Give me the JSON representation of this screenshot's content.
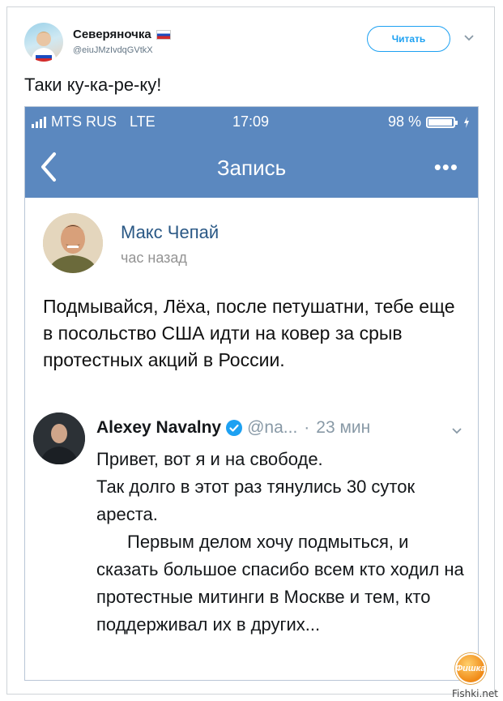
{
  "tweet": {
    "display_name": "Северяночка",
    "handle": "@eiuJMzIvdqGVtkX",
    "follow_label": "Читать",
    "text": "Таки ку-ка-ре-ку!"
  },
  "phone": {
    "status": {
      "carrier": "MTS RUS",
      "network": "LTE",
      "time": "17:09",
      "battery": "98 %",
      "battery_level": 0.98
    },
    "navbar": {
      "title": "Запись",
      "more_label": "•••"
    },
    "post": {
      "author": "Макс Чепай",
      "time": "час назад",
      "text": "Подмывайся, Лёха, после петушатни, тебе еще в посольство США идти на ковер за срыв протестных акций в России."
    },
    "embedded_tweet": {
      "name": "Alexey Navalny",
      "handle": "@na...",
      "separator": "·",
      "time": "23 мин",
      "line1": "Привет, вот я и на свободе.",
      "line2": "Так долго в этот раз тянулись 30 суток ареста.",
      "line3": "Первым делом хочу подмыться, и сказать большое спасибо всем кто ходил на протестные митинги в Москве и тем, кто поддерживал их в других..."
    }
  },
  "watermark": {
    "logo_text": "Фишка",
    "site": "Fishki.net"
  },
  "colors": {
    "twitter_blue": "#1da1f2",
    "vk_header": "#5b88bf",
    "vk_link": "#2a5885"
  }
}
